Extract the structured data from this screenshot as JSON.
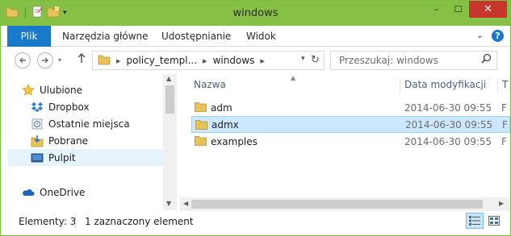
{
  "window": {
    "title": "windows",
    "accent_color": "#86c046",
    "controls": {
      "minimize": "–",
      "maximize": "☐",
      "close": "✕"
    }
  },
  "ribbon": {
    "tabs": [
      {
        "label": "Plik",
        "active": true
      },
      {
        "label": "Narzędzia główne"
      },
      {
        "label": "Udostępnianie"
      },
      {
        "label": "Widok"
      }
    ],
    "expand_glyph": "⌄",
    "help_glyph": "?"
  },
  "address": {
    "segments": [
      "policy_templ...",
      "windows"
    ],
    "search_placeholder": "Przeszukaj: windows"
  },
  "nav_pane": {
    "items": [
      {
        "label": "Ulubione",
        "icon": "star-icon",
        "kind": "header"
      },
      {
        "label": "Dropbox",
        "icon": "dropbox-icon",
        "kind": "sub"
      },
      {
        "label": "Ostatnie miejsca",
        "icon": "recent-places-icon",
        "kind": "sub"
      },
      {
        "label": "Pobrane",
        "icon": "downloads-icon",
        "kind": "sub"
      },
      {
        "label": "Pulpit",
        "icon": "desktop-icon",
        "kind": "sub",
        "selected": true
      },
      {
        "label": "OneDrive",
        "icon": "onedrive-icon",
        "kind": "header"
      }
    ]
  },
  "file_pane": {
    "columns": {
      "name": "Nazwa",
      "date": "Data modyfikacji",
      "type": "T"
    },
    "rows": [
      {
        "name": "adm",
        "date": "2014-06-30 09:55",
        "type": "F",
        "selected": false
      },
      {
        "name": "admx",
        "date": "2014-06-30 09:55",
        "type": "F",
        "selected": true
      },
      {
        "name": "examples",
        "date": "2014-06-30 09:55",
        "type": "F",
        "selected": false
      }
    ]
  },
  "status": {
    "count": "Elementy: 3",
    "selection": "1 zaznaczony element"
  }
}
